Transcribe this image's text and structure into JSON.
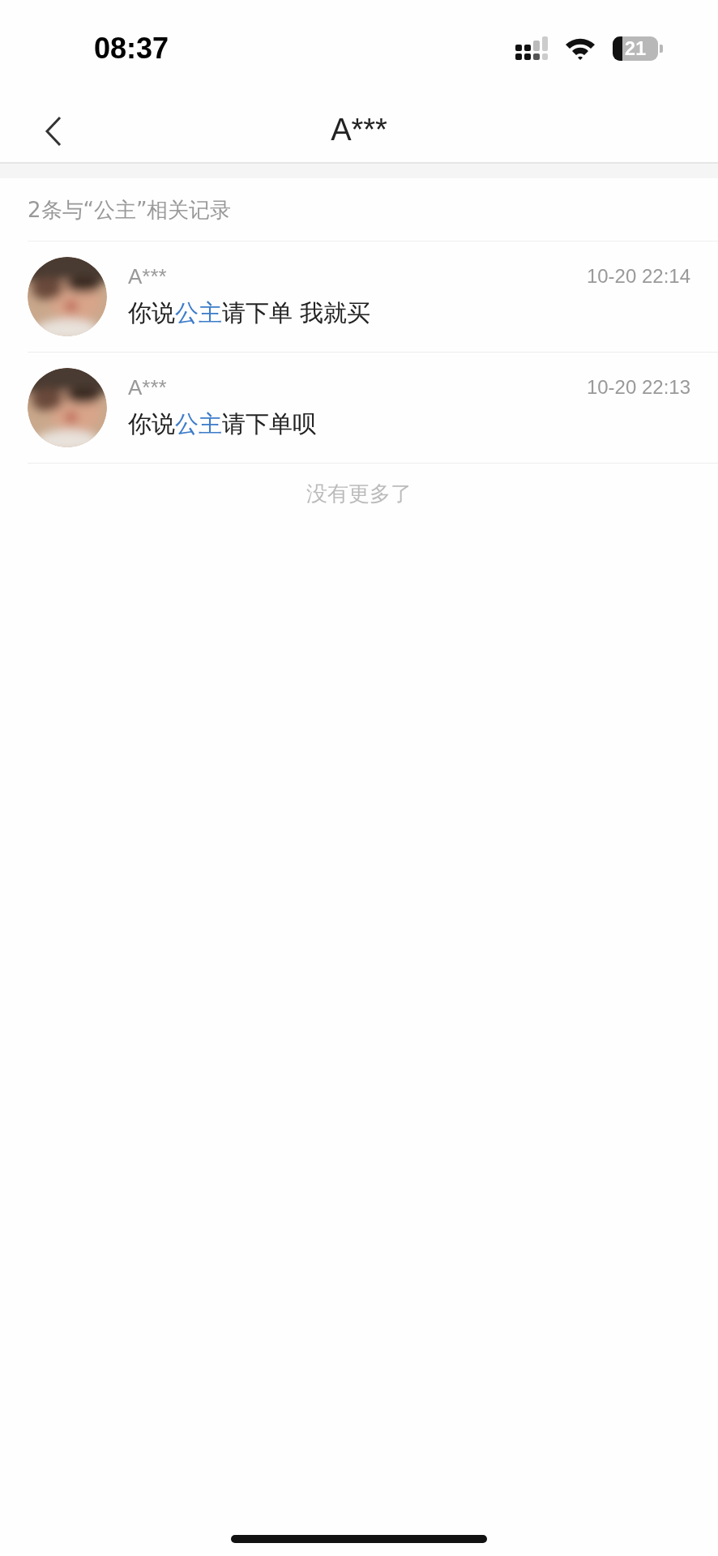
{
  "status_bar": {
    "time": "08:37",
    "battery": "21"
  },
  "nav": {
    "title": "A***"
  },
  "summary": "2条与“公主”相关记录",
  "results": [
    {
      "name": "A***",
      "time": "10-20 22:14",
      "message": [
        {
          "text": "你说",
          "highlight": false
        },
        {
          "text": "公主",
          "highlight": true
        },
        {
          "text": "请下单 我就买",
          "highlight": false
        }
      ]
    },
    {
      "name": "A***",
      "time": "10-20 22:13",
      "message": [
        {
          "text": "你说",
          "highlight": false
        },
        {
          "text": "公主",
          "highlight": true
        },
        {
          "text": "请下单呗",
          "highlight": false
        }
      ]
    }
  ],
  "footer": "没有更多了"
}
